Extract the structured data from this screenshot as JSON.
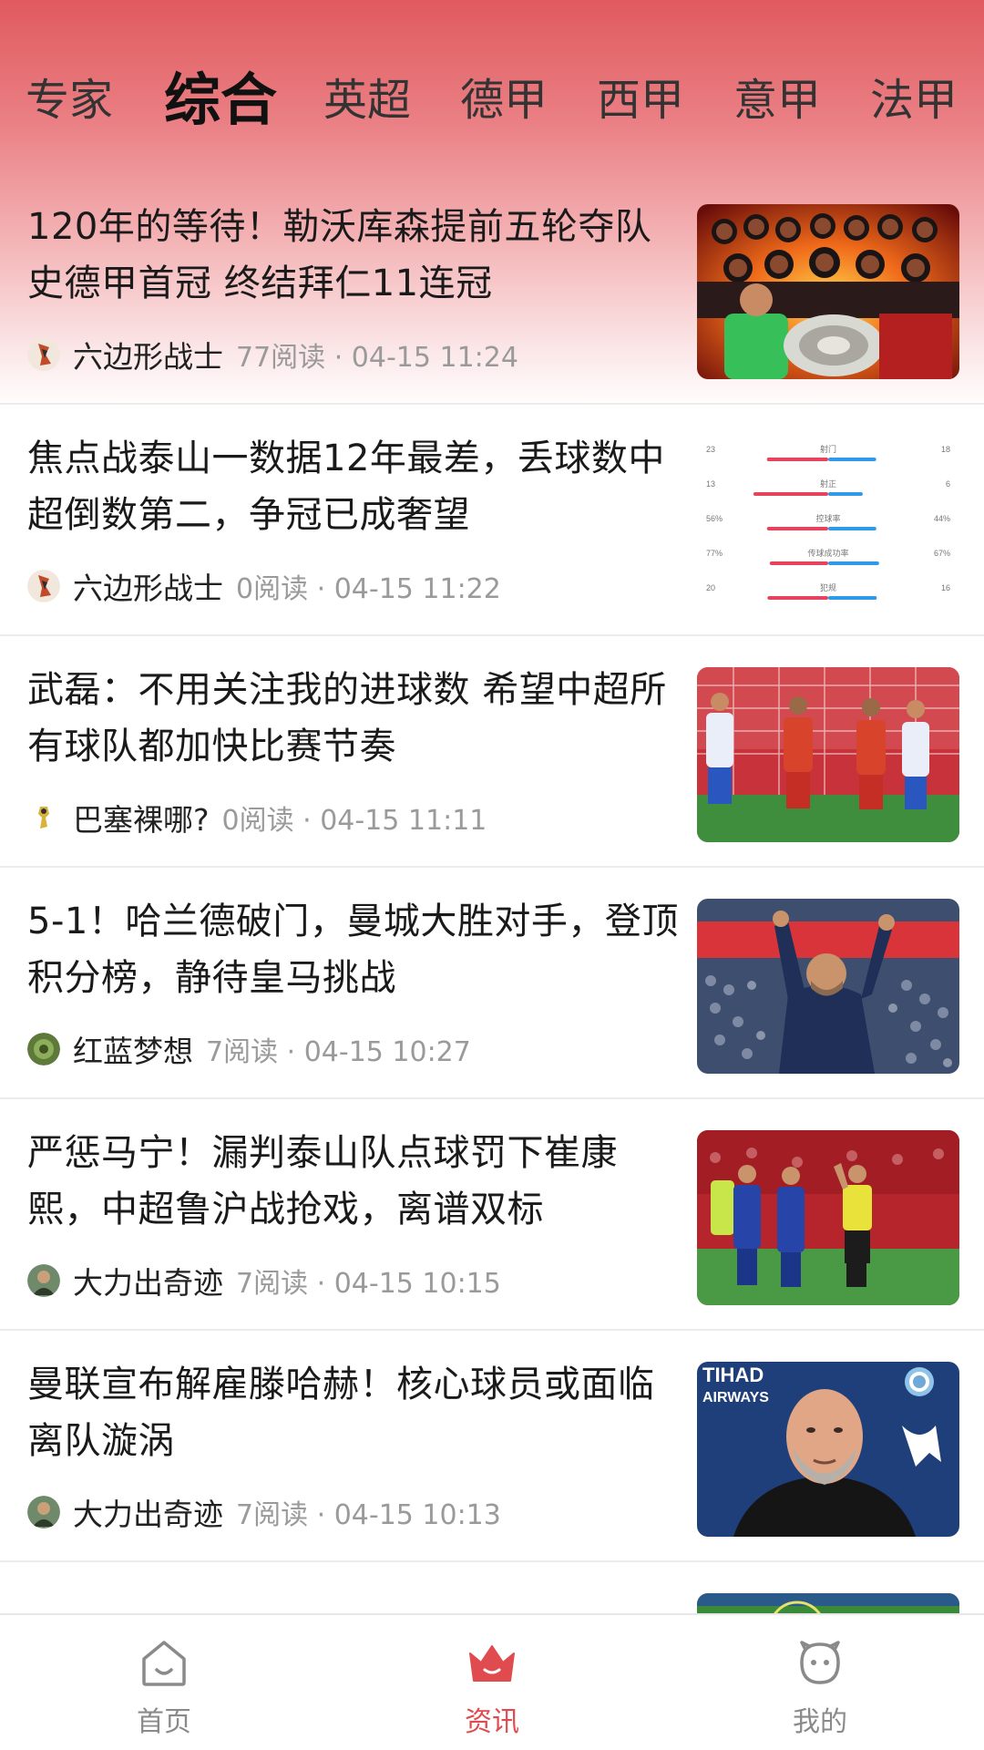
{
  "tabs": [
    {
      "label": "专家",
      "active": false
    },
    {
      "label": "综合",
      "active": true
    },
    {
      "label": "英超",
      "active": false
    },
    {
      "label": "德甲",
      "active": false
    },
    {
      "label": "西甲",
      "active": false
    },
    {
      "label": "意甲",
      "active": false
    },
    {
      "label": "法甲",
      "active": false
    }
  ],
  "articles": [
    {
      "title": "120年的等待！勒沃库森提前五轮夺队史德甲首冠 终结拜仁11连冠",
      "author": "六边形战士",
      "readinfo": "77阅读 · 04-15 11:24",
      "thumb": "team-celebration-photo"
    },
    {
      "title": "焦点战泰山一数据12年最差，丢球数中超倒数第二，争冠已成奢望",
      "author": "六边形战士",
      "readinfo": "0阅读 · 04-15 11:22",
      "thumb": "match-stats-chart"
    },
    {
      "title": "武磊：不用关注我的进球数 希望中超所有球队都加快比赛节奏",
      "author": "巴塞裸哪?",
      "readinfo": "0阅读 · 04-15 11:11",
      "thumb": "goalmouth-photo"
    },
    {
      "title": "5-1！哈兰德破门，曼城大胜对手，登顶积分榜，静待皇马挑战",
      "author": "红蓝梦想",
      "readinfo": "7阅读 · 04-15 10:27",
      "thumb": "manager-applause-photo"
    },
    {
      "title": "严惩马宁！漏判泰山队点球罚下崔康熙，中超鲁沪战抢戏，离谱双标",
      "author": "大力出奇迹",
      "readinfo": "7阅读 · 04-15 10:15",
      "thumb": "referee-photo"
    },
    {
      "title": "曼联宣布解雇滕哈赫！核心球员或面临离队漩涡",
      "author": "大力出奇迹",
      "readinfo": "7阅读 · 04-15 10:13",
      "thumb": "coach-portrait-photo"
    }
  ],
  "thumb_texts": {
    "sponsor_line1": "TIHAD",
    "sponsor_line2": "AIRWAYS"
  },
  "stats_rows": [
    {
      "left": "23",
      "label": "射门",
      "right": "18"
    },
    {
      "left": "13",
      "label": "射正",
      "right": "6"
    },
    {
      "left": "56%",
      "label": "控球率",
      "right": "44%"
    },
    {
      "left": "77%",
      "label": "传球成功率",
      "right": "67%"
    },
    {
      "left": "20",
      "label": "犯规",
      "right": "16"
    }
  ],
  "bottom_nav": [
    {
      "label": "首页",
      "icon": "home-icon",
      "active": false
    },
    {
      "label": "资讯",
      "icon": "crown-icon",
      "active": true
    },
    {
      "label": "我的",
      "icon": "smiley-face-icon",
      "active": false
    }
  ],
  "colors": {
    "accent": "#e04b4f",
    "header_gradient_top": "#e05a5e",
    "stat_red": "#e8435d",
    "stat_blue": "#2f9be8"
  }
}
